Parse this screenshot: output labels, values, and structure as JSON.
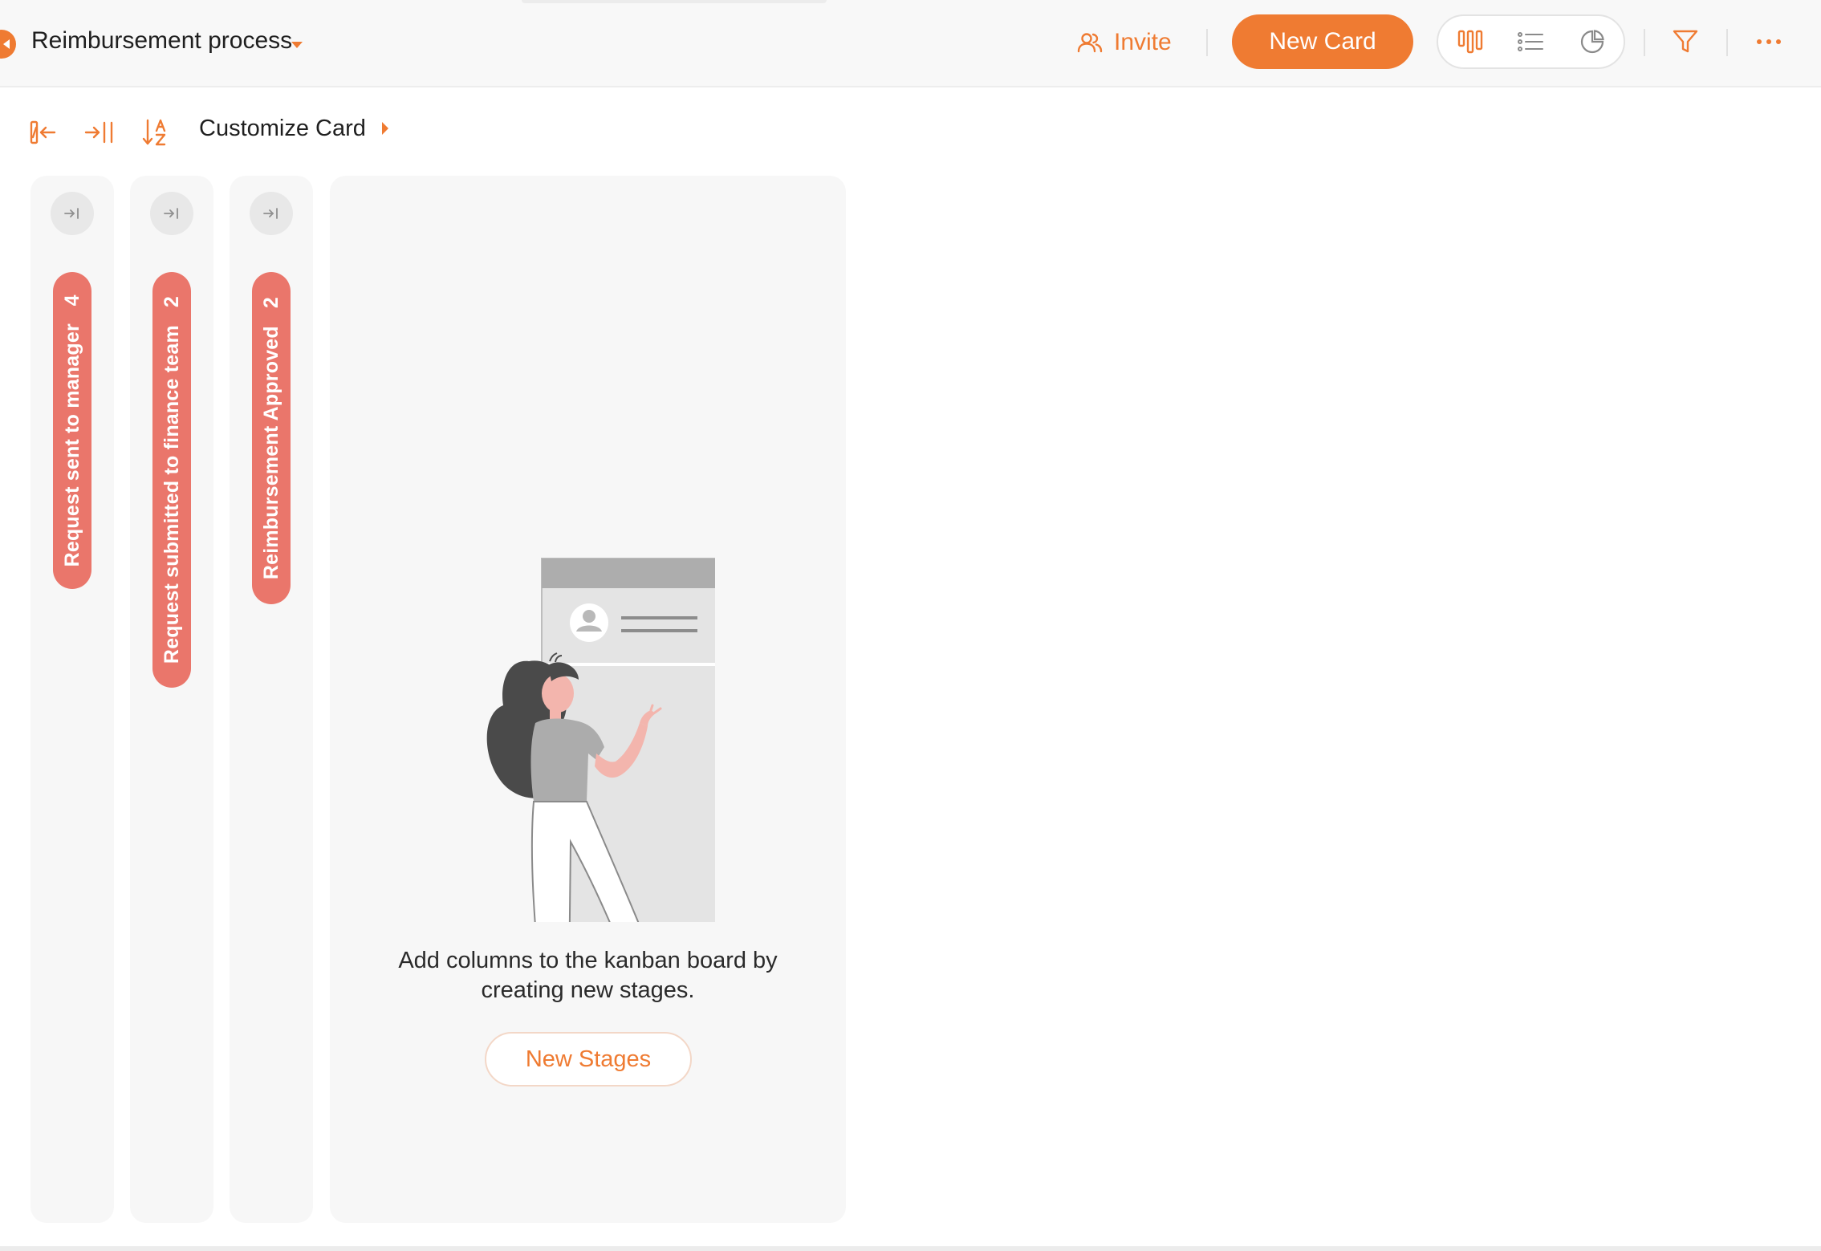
{
  "header": {
    "board_title": "Reimbursement process",
    "invite_label": "Invite",
    "new_card_label": "New Card"
  },
  "toolbar": {
    "customize_label": "Customize Card"
  },
  "stages": [
    {
      "name": "Request sent to manager",
      "count": "4"
    },
    {
      "name": "Request submitted to finance team",
      "count": "2"
    },
    {
      "name": "Reimbursement Approved",
      "count": "2"
    }
  ],
  "empty_state": {
    "line1": "Add columns to the kanban board by",
    "line2": "creating new stages.",
    "button_label": "New Stages"
  },
  "colors": {
    "accent": "#ef7b32",
    "stage_pill": "#ea766b",
    "column_bg": "#f7f7f7"
  },
  "icons": [
    "back-icon",
    "caret-down-icon",
    "invite-users-icon",
    "kanban-view-icon",
    "list-view-icon",
    "chart-view-icon",
    "filter-icon",
    "more-icon",
    "collapse-columns-icon",
    "expand-columns-icon",
    "sort-az-icon",
    "caret-right-icon",
    "expand-column-icon"
  ]
}
